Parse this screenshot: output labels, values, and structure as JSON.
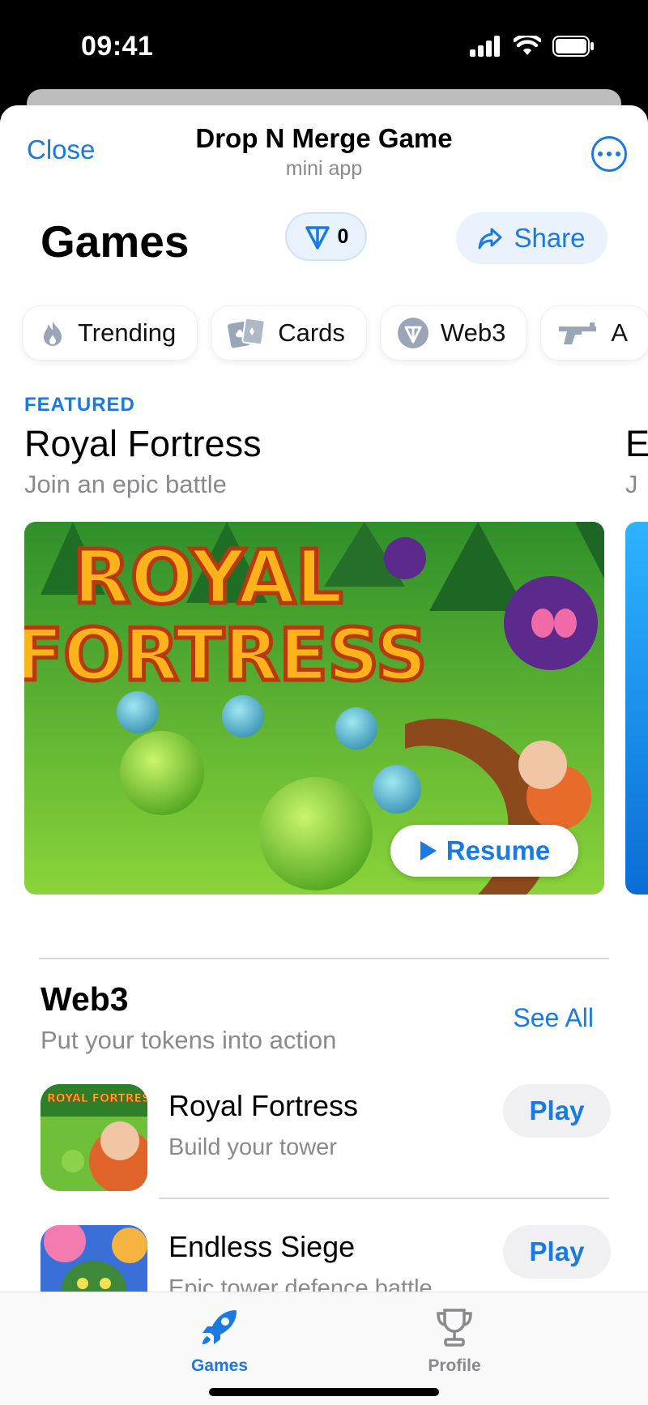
{
  "status": {
    "time": "09:41"
  },
  "nav": {
    "close_label": "Close",
    "title": "Drop N Merge Game",
    "subtitle": "mini app"
  },
  "header": {
    "title": "Games",
    "coin_count": "0",
    "share_label": "Share"
  },
  "chips": [
    {
      "label": "Trending",
      "icon": "flame-icon"
    },
    {
      "label": "Cards",
      "icon": "cards-icon"
    },
    {
      "label": "Web3",
      "icon": "ton-icon"
    },
    {
      "label": "A",
      "icon": "gun-icon"
    }
  ],
  "featured": {
    "label": "FEATURED",
    "title": "Royal Fortress",
    "subtitle": "Join an epic battle",
    "banner_line1": "ROYAL",
    "banner_line2": "FORTRESS",
    "resume_label": "Resume",
    "peek_title": "E",
    "peek_sub": "J"
  },
  "section": {
    "title": "Web3",
    "subtitle": "Put your tokens into action",
    "see_all_label": "See All",
    "games": [
      {
        "name": "Royal Fortress",
        "description": "Build your tower",
        "play_label": "Play",
        "thumb_text": "ROYAL FORTRESS"
      },
      {
        "name": "Endless Siege",
        "description": "Epic tower defence battle ...",
        "play_label": "Play"
      }
    ]
  },
  "tabs": [
    {
      "label": "Games",
      "icon": "rocket-icon",
      "active": true
    },
    {
      "label": "Profile",
      "icon": "trophy-icon",
      "active": false
    }
  ],
  "colors": {
    "accent": "#1a7ae0",
    "muted": "#8a8a8e",
    "inactive_tab": "#8a8a8e"
  }
}
